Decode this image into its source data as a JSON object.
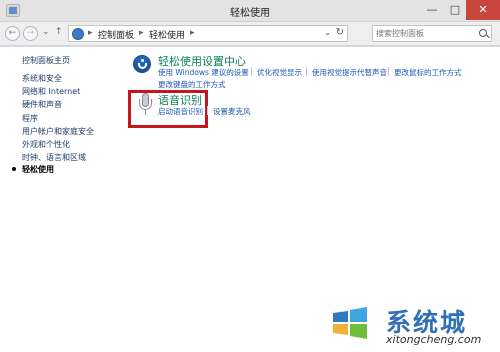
{
  "window": {
    "title": "轻松使用",
    "minimize_label": "—",
    "maximize_label": "□",
    "close_label": "✕"
  },
  "navigation": {
    "back_glyph": "←",
    "forward_glyph": "→",
    "up_glyph": "↑",
    "recent_glyph": "⌄"
  },
  "address_bar": {
    "separator": "▸",
    "breadcrumbs": [
      "控制面板",
      "轻松使用"
    ],
    "dropdown_glyph": "⌄",
    "refresh_glyph": "↻"
  },
  "search": {
    "placeholder": "搜索控制面板"
  },
  "sidebar": {
    "items": [
      {
        "label": "控制面板主页"
      },
      {
        "label": "系统和安全"
      },
      {
        "label": "网络和 Internet"
      },
      {
        "label": "硬件和声音"
      },
      {
        "label": "程序"
      },
      {
        "label": "用户帐户和家庭安全"
      },
      {
        "label": "外观和个性化"
      },
      {
        "label": "时钟、语言和区域"
      },
      {
        "label": "轻松使用"
      }
    ],
    "current_item": "轻松使用"
  },
  "categories": [
    {
      "icon": "ease-of-access-icon",
      "title": "轻松使用设置中心",
      "links": [
        "使用 Windows 建议的设置",
        "优化视觉显示",
        "使用视觉提示代替声音",
        "更改鼠标的工作方式",
        "更改键盘的工作方式"
      ]
    },
    {
      "icon": "microphone-icon",
      "title": "语音识别",
      "links": [
        "启动语音识别",
        "设置麦克风"
      ],
      "highlighted": true
    }
  ],
  "watermark": {
    "brand": "系统城",
    "url": "xitongcheng.com"
  },
  "colors": {
    "title_bar": "#e3e3e3",
    "link_blue": "#1a58b8",
    "category_title_green": "#0f7f5a",
    "highlight_red": "#c5161d",
    "close_button_red": "#c9463d",
    "sidebar_text": "#1f3e69",
    "watermark_blue": "#2f70b8"
  }
}
